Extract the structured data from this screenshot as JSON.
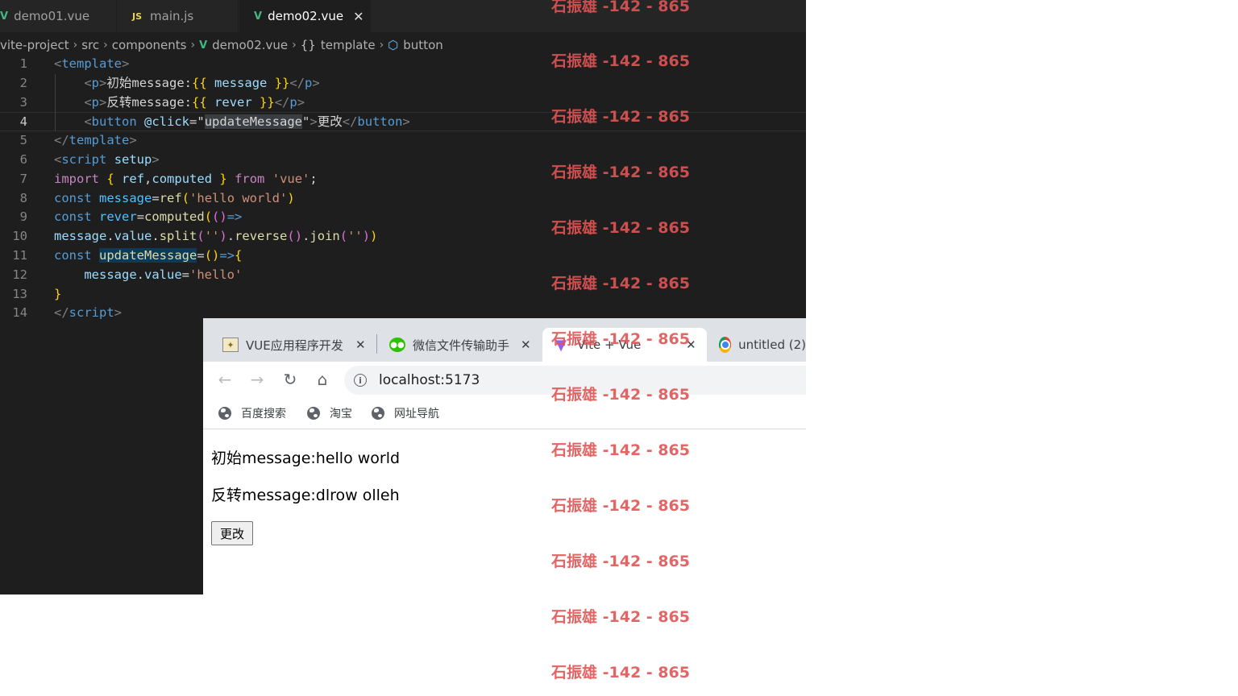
{
  "editor": {
    "tabs": [
      {
        "label": "demo01.vue",
        "icon": "vue-icon",
        "active": false
      },
      {
        "label": "main.js",
        "icon": "js-icon",
        "icon_text": "JS",
        "active": false
      },
      {
        "label": "demo02.vue",
        "icon": "vue-icon",
        "active": true,
        "close": "✕"
      }
    ],
    "breadcrumb": [
      "vite-project",
      "src",
      "components",
      "demo02.vue",
      "template",
      "button"
    ],
    "current_line": 4,
    "lines": [
      {
        "n": "1",
        "tokens": [
          [
            "<",
            "#808080"
          ],
          [
            "template",
            "#569cd6"
          ],
          [
            ">",
            "#808080"
          ]
        ]
      },
      {
        "n": "2",
        "tokens": [
          [
            "    ",
            "#d4d4d4"
          ],
          [
            "<",
            "#808080"
          ],
          [
            "p",
            "#569cd6"
          ],
          [
            ">",
            "#808080"
          ],
          [
            "初始message:",
            "#d4d4d4"
          ],
          [
            "{{",
            "#ffd700"
          ],
          [
            " ",
            "#d4d4d4"
          ],
          [
            "message",
            "#9cdcfe"
          ],
          [
            " ",
            "#d4d4d4"
          ],
          [
            "}}",
            "#ffd700"
          ],
          [
            "</",
            "#808080"
          ],
          [
            "p",
            "#569cd6"
          ],
          [
            ">",
            "#808080"
          ]
        ]
      },
      {
        "n": "3",
        "tokens": [
          [
            "    ",
            "#d4d4d4"
          ],
          [
            "<",
            "#808080"
          ],
          [
            "p",
            "#569cd6"
          ],
          [
            ">",
            "#808080"
          ],
          [
            "反转message:",
            "#d4d4d4"
          ],
          [
            "{{",
            "#ffd700"
          ],
          [
            " ",
            "#d4d4d4"
          ],
          [
            "rever",
            "#9cdcfe"
          ],
          [
            " ",
            "#d4d4d4"
          ],
          [
            "}}",
            "#ffd700"
          ],
          [
            "</",
            "#808080"
          ],
          [
            "p",
            "#569cd6"
          ],
          [
            ">",
            "#808080"
          ]
        ]
      },
      {
        "n": "4",
        "tokens": [
          [
            "    ",
            "#d4d4d4"
          ],
          [
            "<",
            "#808080"
          ],
          [
            "button",
            "#569cd6"
          ],
          [
            " ",
            "#d4d4d4"
          ],
          [
            "@click",
            "#9cdcfe"
          ],
          [
            "=",
            "#d4d4d4"
          ],
          [
            "\"",
            "#d4d4d4"
          ],
          [
            "updateMessage",
            "#d4d4d4",
            "#3a3d41"
          ],
          [
            "\"",
            "#d4d4d4"
          ],
          [
            ">",
            "#808080"
          ],
          [
            "更改",
            "#d4d4d4"
          ],
          [
            "</",
            "#808080"
          ],
          [
            "button",
            "#569cd6"
          ],
          [
            ">",
            "#808080"
          ]
        ]
      },
      {
        "n": "5",
        "tokens": [
          [
            "</",
            "#808080"
          ],
          [
            "template",
            "#569cd6"
          ],
          [
            ">",
            "#808080"
          ]
        ]
      },
      {
        "n": "6",
        "tokens": [
          [
            "<",
            "#808080"
          ],
          [
            "script",
            "#569cd6"
          ],
          [
            " ",
            "#d4d4d4"
          ],
          [
            "setup",
            "#9cdcfe"
          ],
          [
            ">",
            "#808080"
          ]
        ]
      },
      {
        "n": "7",
        "tokens": [
          [
            "import",
            "#c586c0"
          ],
          [
            " ",
            "#d4d4d4"
          ],
          [
            "{",
            "#ffd700"
          ],
          [
            " ",
            "#d4d4d4"
          ],
          [
            "ref",
            "#9cdcfe"
          ],
          [
            ",",
            "#d4d4d4"
          ],
          [
            "computed",
            "#9cdcfe"
          ],
          [
            " ",
            "#d4d4d4"
          ],
          [
            "}",
            "#ffd700"
          ],
          [
            " ",
            "#d4d4d4"
          ],
          [
            "from",
            "#c586c0"
          ],
          [
            " ",
            "#d4d4d4"
          ],
          [
            "'vue'",
            "#ce9178"
          ],
          [
            ";",
            "#d4d4d4"
          ]
        ]
      },
      {
        "n": "8",
        "tokens": [
          [
            "const",
            "#569cd6"
          ],
          [
            " ",
            "#d4d4d4"
          ],
          [
            "message",
            "#4fc1ff"
          ],
          [
            "=",
            "#d4d4d4"
          ],
          [
            "ref",
            "#dcdcaa"
          ],
          [
            "(",
            "#ffd700"
          ],
          [
            "'hello world'",
            "#ce9178"
          ],
          [
            ")",
            "#ffd700"
          ]
        ]
      },
      {
        "n": "9",
        "tokens": [
          [
            "const",
            "#569cd6"
          ],
          [
            " ",
            "#d4d4d4"
          ],
          [
            "rever",
            "#4fc1ff"
          ],
          [
            "=",
            "#d4d4d4"
          ],
          [
            "computed",
            "#dcdcaa"
          ],
          [
            "(",
            "#ffd700"
          ],
          [
            "()",
            "#da70d6"
          ],
          [
            "=>",
            "#569cd6"
          ]
        ]
      },
      {
        "n": "10",
        "tokens": [
          [
            "message",
            "#9cdcfe"
          ],
          [
            ".",
            "#d4d4d4"
          ],
          [
            "value",
            "#9cdcfe"
          ],
          [
            ".",
            "#d4d4d4"
          ],
          [
            "split",
            "#dcdcaa"
          ],
          [
            "(",
            "#da70d6"
          ],
          [
            "''",
            "#ce9178"
          ],
          [
            ")",
            "#da70d6"
          ],
          [
            ".",
            "#d4d4d4"
          ],
          [
            "reverse",
            "#dcdcaa"
          ],
          [
            "()",
            "#da70d6"
          ],
          [
            ".",
            "#d4d4d4"
          ],
          [
            "join",
            "#dcdcaa"
          ],
          [
            "(",
            "#da70d6"
          ],
          [
            "''",
            "#ce9178"
          ],
          [
            ")",
            "#da70d6"
          ],
          [
            ")",
            "#ffd700"
          ]
        ]
      },
      {
        "n": "11",
        "tokens": [
          [
            "const",
            "#569cd6"
          ],
          [
            " ",
            "#d4d4d4"
          ],
          [
            "updateMessage",
            "#dcdcaa",
            "#0e3a57"
          ],
          [
            "=",
            "#d4d4d4"
          ],
          [
            "()",
            "#ffd700"
          ],
          [
            "=>",
            "#569cd6"
          ],
          [
            "{",
            "#ffd700"
          ]
        ]
      },
      {
        "n": "12",
        "tokens": [
          [
            "    ",
            "#d4d4d4"
          ],
          [
            "message",
            "#9cdcfe"
          ],
          [
            ".",
            "#d4d4d4"
          ],
          [
            "value",
            "#9cdcfe"
          ],
          [
            "=",
            "#d4d4d4"
          ],
          [
            "'hello'",
            "#ce9178"
          ]
        ]
      },
      {
        "n": "13",
        "tokens": [
          [
            "}",
            "#ffd700"
          ]
        ]
      },
      {
        "n": "14",
        "tokens": [
          [
            "</",
            "#808080"
          ],
          [
            "script",
            "#569cd6"
          ],
          [
            ">",
            "#808080"
          ]
        ]
      }
    ]
  },
  "browser": {
    "tabs": [
      {
        "label": "VUE应用程序开发",
        "icon": "app-icon",
        "close": "✕"
      },
      {
        "label": "微信文件传输助手",
        "icon": "wechat-icon",
        "close": "✕"
      },
      {
        "label": "Vite + Vue",
        "icon": "vite-icon",
        "close": "✕",
        "active": true
      },
      {
        "label": "untitled (2)",
        "icon": "chrome-icon"
      }
    ],
    "url": "localhost:5173",
    "info_glyph": "i",
    "nav": {
      "back": "←",
      "forward": "→",
      "reload": "↻",
      "home": "⌂"
    },
    "bookmarks": [
      "百度搜索",
      "淘宝",
      "网址导航"
    ],
    "page": {
      "line1": "初始message:hello world",
      "line2": "反转message:dlrow olleh",
      "button": "更改"
    }
  },
  "watermark": {
    "text": "石振雄 -142 - 865",
    "color": "#e05555"
  }
}
